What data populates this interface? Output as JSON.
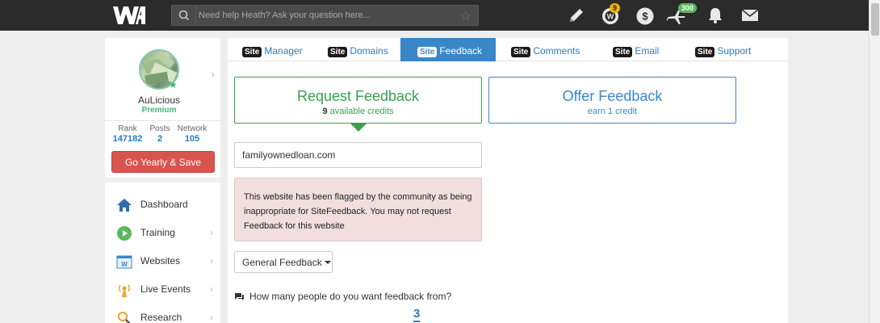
{
  "topbar": {
    "search": {
      "placeholder": "Need help Heath? Ask your question here...",
      "value": ""
    },
    "badges": {
      "wa_count": "9",
      "plane_count": "300"
    }
  },
  "profile": {
    "username": "AuLicious",
    "tier": "Premium",
    "stats": [
      {
        "label": "Rank",
        "value": "147182"
      },
      {
        "label": "Posts",
        "value": "2"
      },
      {
        "label": "Network",
        "value": "105"
      }
    ],
    "cta_label": "Go Yearly & Save"
  },
  "nav": {
    "items": [
      {
        "label": "Dashboard",
        "icon": "home-icon"
      },
      {
        "label": "Training",
        "icon": "play-icon"
      },
      {
        "label": "Websites",
        "icon": "website-icon"
      },
      {
        "label": "Live Events",
        "icon": "broadcast-icon"
      },
      {
        "label": "Research",
        "icon": "research-icon"
      }
    ]
  },
  "tabs": {
    "site_tag": "Site",
    "items": [
      {
        "label": "Manager",
        "active": false
      },
      {
        "label": "Domains",
        "active": false
      },
      {
        "label": "Feedback",
        "active": true
      },
      {
        "label": "Comments",
        "active": false
      },
      {
        "label": "Email",
        "active": false
      },
      {
        "label": "Support",
        "active": false
      }
    ]
  },
  "feedback": {
    "request": {
      "title": "Request Feedback",
      "credits": "9",
      "credits_suffix": " available credits"
    },
    "offer": {
      "title": "Offer Feedback",
      "subtitle": "earn 1 credit"
    },
    "selected_site": "familyownedloan.com",
    "warning": "This website has been flagged by the community as being inappropriate for SiteFeedback. You may not request Feedback for this website",
    "type_label": "General Feedback",
    "people_question": "How many people do you want feedback from?",
    "people_count": "3"
  },
  "colors": {
    "topbar_bg": "#2b2b2b",
    "accent_blue": "#3a87c8",
    "accent_green": "#3a9e4e",
    "danger": "#d9534f",
    "warning_bg": "#f2dede"
  }
}
